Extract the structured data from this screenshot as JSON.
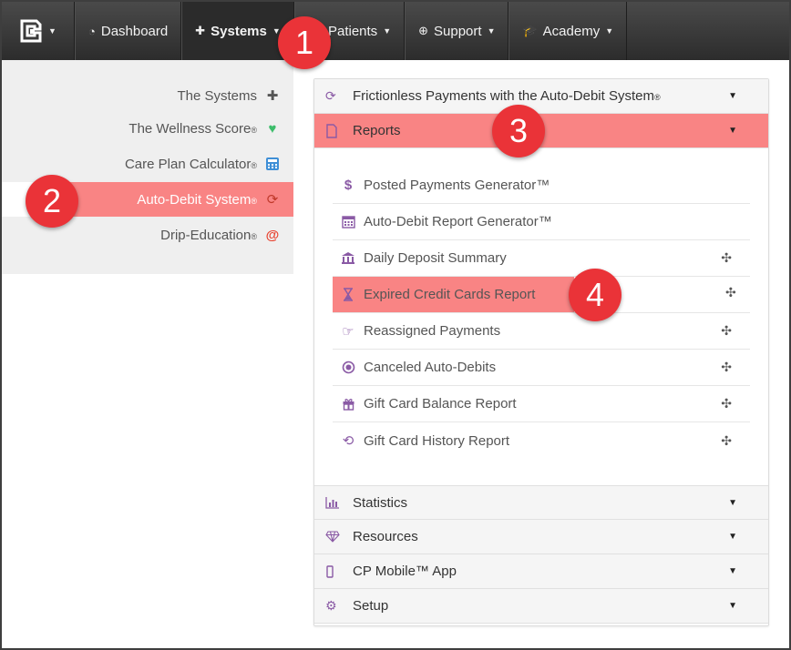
{
  "navbar": {
    "items": [
      {
        "label": "Dashboard",
        "icon": "dashboard-icon"
      },
      {
        "label": "Systems",
        "icon": "puzzle-icon"
      },
      {
        "label": "Patients",
        "icon": "users-icon"
      },
      {
        "label": "Support",
        "icon": "lifebuoy-icon"
      },
      {
        "label": "Academy",
        "icon": "graduation-cap-icon"
      }
    ]
  },
  "sidebar": {
    "items": [
      {
        "label": "The Systems",
        "icon": "puzzle-icon"
      },
      {
        "label": "The Wellness Score",
        "icon": "heart-pulse-icon",
        "reg": "®"
      },
      {
        "label": "Care Plan Calculator",
        "icon": "calculator-icon",
        "reg": "®"
      },
      {
        "label": "Auto-Debit System",
        "icon": "refresh-icon",
        "reg": "®"
      },
      {
        "label": "Drip-Education",
        "icon": "at-sign-icon",
        "reg": "®"
      }
    ]
  },
  "accordion": {
    "panels": [
      {
        "label": "Frictionless Payments with the Auto-Debit System",
        "reg": "®",
        "icon": "refresh-icon"
      },
      {
        "label": "Reports",
        "icon": "file-icon"
      },
      {
        "label": "Statistics",
        "icon": "bar-chart-icon"
      },
      {
        "label": "Resources",
        "icon": "diamond-icon"
      },
      {
        "label": "CP Mobile™ App",
        "icon": "mobile-icon"
      },
      {
        "label": "Setup",
        "icon": "gears-icon"
      }
    ],
    "reports": [
      {
        "label": "Posted Payments Generator™",
        "icon": "dollar-icon",
        "pinned": false
      },
      {
        "label": "Auto-Debit Report Generator™",
        "icon": "calendar-icon",
        "pinned": false
      },
      {
        "label": "Daily Deposit Summary",
        "icon": "bank-icon",
        "pinned": true
      },
      {
        "label": "Expired Credit Cards Report",
        "icon": "hourglass-icon",
        "pinned": true
      },
      {
        "label": "Reassigned Payments",
        "icon": "hand-point-icon",
        "pinned": true
      },
      {
        "label": "Canceled Auto-Debits",
        "icon": "stop-circle-icon",
        "pinned": true
      },
      {
        "label": "Gift Card Balance Report",
        "icon": "gift-icon",
        "pinned": true
      },
      {
        "label": "Gift Card History Report",
        "icon": "history-icon",
        "pinned": true
      }
    ]
  },
  "callouts": [
    "1",
    "2",
    "3",
    "4"
  ],
  "colors": {
    "highlight": "#f98484",
    "callout": "#ea3338",
    "icon_purple": "#8a5aa5",
    "navbar": "#3a3a3a"
  }
}
